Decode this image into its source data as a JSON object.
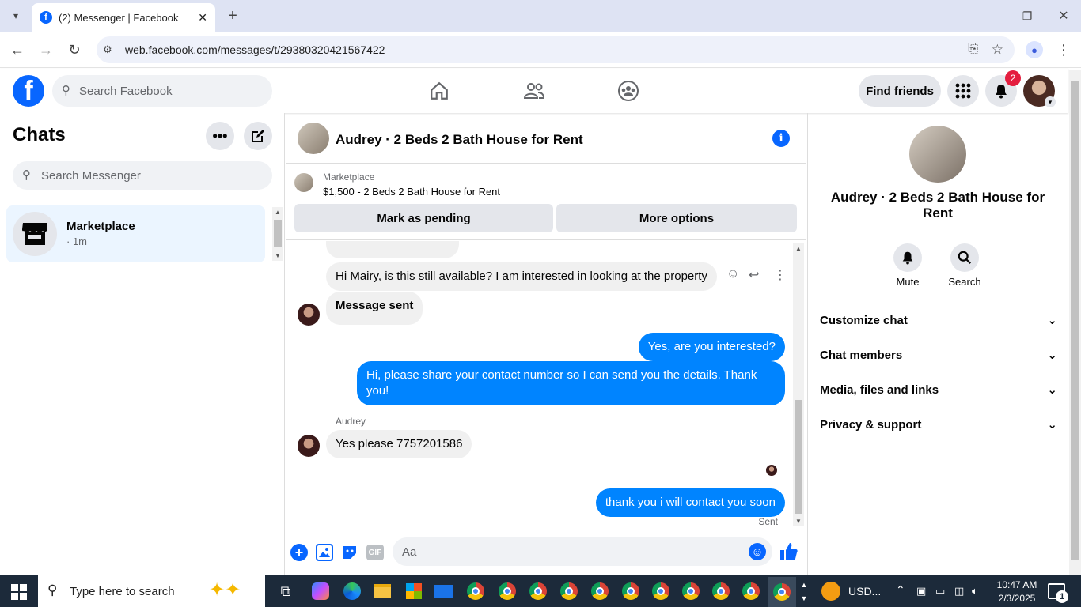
{
  "browser": {
    "tab_title": "(2) Messenger | Facebook",
    "url": "web.facebook.com/messages/t/29380320421567422"
  },
  "fb": {
    "search_placeholder": "Search Facebook",
    "find_friends": "Find friends",
    "notif_count": "2"
  },
  "left": {
    "title": "Chats",
    "search_placeholder": "Search Messenger",
    "chat": {
      "name": "Marketplace",
      "time": "· 1m"
    }
  },
  "conversation": {
    "title": "Audrey · 2 Beds 2 Bath House for Rent",
    "marketplace_label": "Marketplace",
    "listing": "$1,500 - 2 Beds 2 Bath House for Rent",
    "mark_pending": "Mark as pending",
    "more_options": "More options",
    "messages": [
      {
        "dir": "in",
        "text": "Hi Mairy, is this still available? I am interested in looking at the property"
      },
      {
        "dir": "in",
        "text": "Message sent"
      },
      {
        "dir": "out",
        "text": "Yes, are you interested?"
      },
      {
        "dir": "out",
        "text": "Hi, please share your contact number so I can send you the details. Thank you!"
      },
      {
        "dir": "in",
        "sender": "Audrey",
        "text": "Yes please 7757201586"
      },
      {
        "dir": "out",
        "text": "thank you i will contact you soon"
      }
    ],
    "sent_status": "Sent",
    "composer_placeholder": "Aa"
  },
  "right": {
    "name": "Audrey · 2 Beds 2 Bath House for Rent",
    "mute": "Mute",
    "search": "Search",
    "sections": [
      "Customize chat",
      "Chat members",
      "Media, files and links",
      "Privacy & support"
    ]
  },
  "taskbar": {
    "search_placeholder": "Type here to search",
    "currency": "USD...",
    "time": "10:47 AM",
    "date": "2/3/2025",
    "notif": "1"
  },
  "colors": {
    "fb_blue": "#0866ff",
    "bubble_out": "#0084ff",
    "bubble_in": "#f0f0f0"
  }
}
